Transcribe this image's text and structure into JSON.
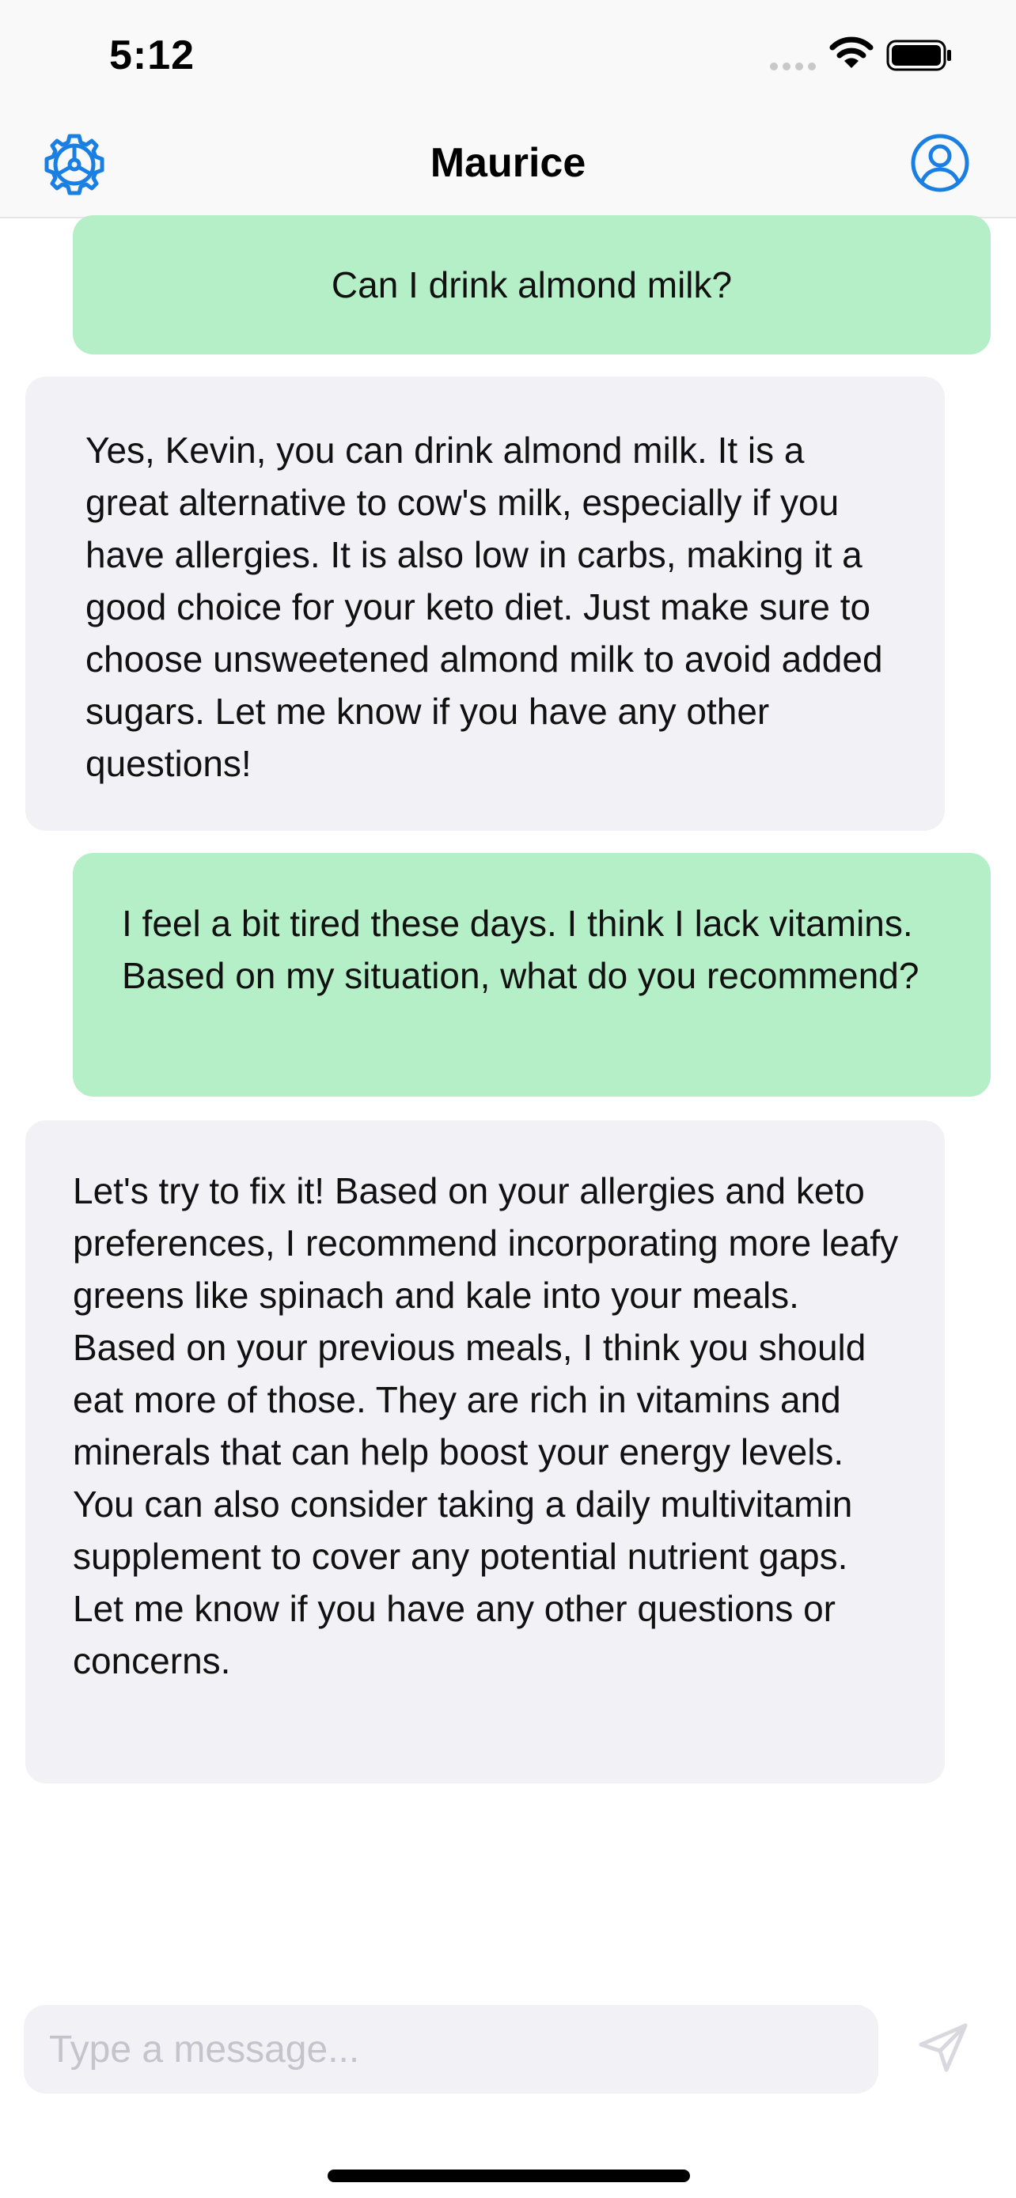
{
  "status_bar": {
    "time": "5:12"
  },
  "nav": {
    "title": "Maurice",
    "settings_icon": "gear-icon",
    "profile_icon": "person-circle-icon",
    "accent_color": "#1a7fe3"
  },
  "messages": [
    {
      "role": "user",
      "text": "Can I drink almond milk?"
    },
    {
      "role": "assistant",
      "text": "Yes, Kevin, you can drink almond milk. It is a great alternative to cow's milk, especially if you have allergies. It is also low in carbs, making it a good choice for your keto diet. Just make sure to choose unsweetened almond milk to avoid added sugars. Let me know if you have any other questions!"
    },
    {
      "role": "user",
      "text": "I feel a bit tired these days. I think I lack vitamins. Based on my situation, what do you recommend?"
    },
    {
      "role": "assistant",
      "text": "Let's try to fix it! Based on your allergies and keto preferences, I recommend incorporating more leafy greens like spinach and kale into your meals. Based on your previous meals, I think you should eat more of those. They are rich in vitamins and minerals that can help boost your energy levels. You can also consider taking a daily multivitamin supplement to cover any potential nutrient gaps. Let me know if you have any other questions or concerns."
    }
  ],
  "composer": {
    "placeholder": "Type a message...",
    "value": "",
    "send_icon": "paper-plane-icon"
  },
  "colors": {
    "user_bubble": "#b5efc7",
    "assistant_bubble": "#f1f1f6",
    "send_icon_disabled": "#d8d8de"
  }
}
